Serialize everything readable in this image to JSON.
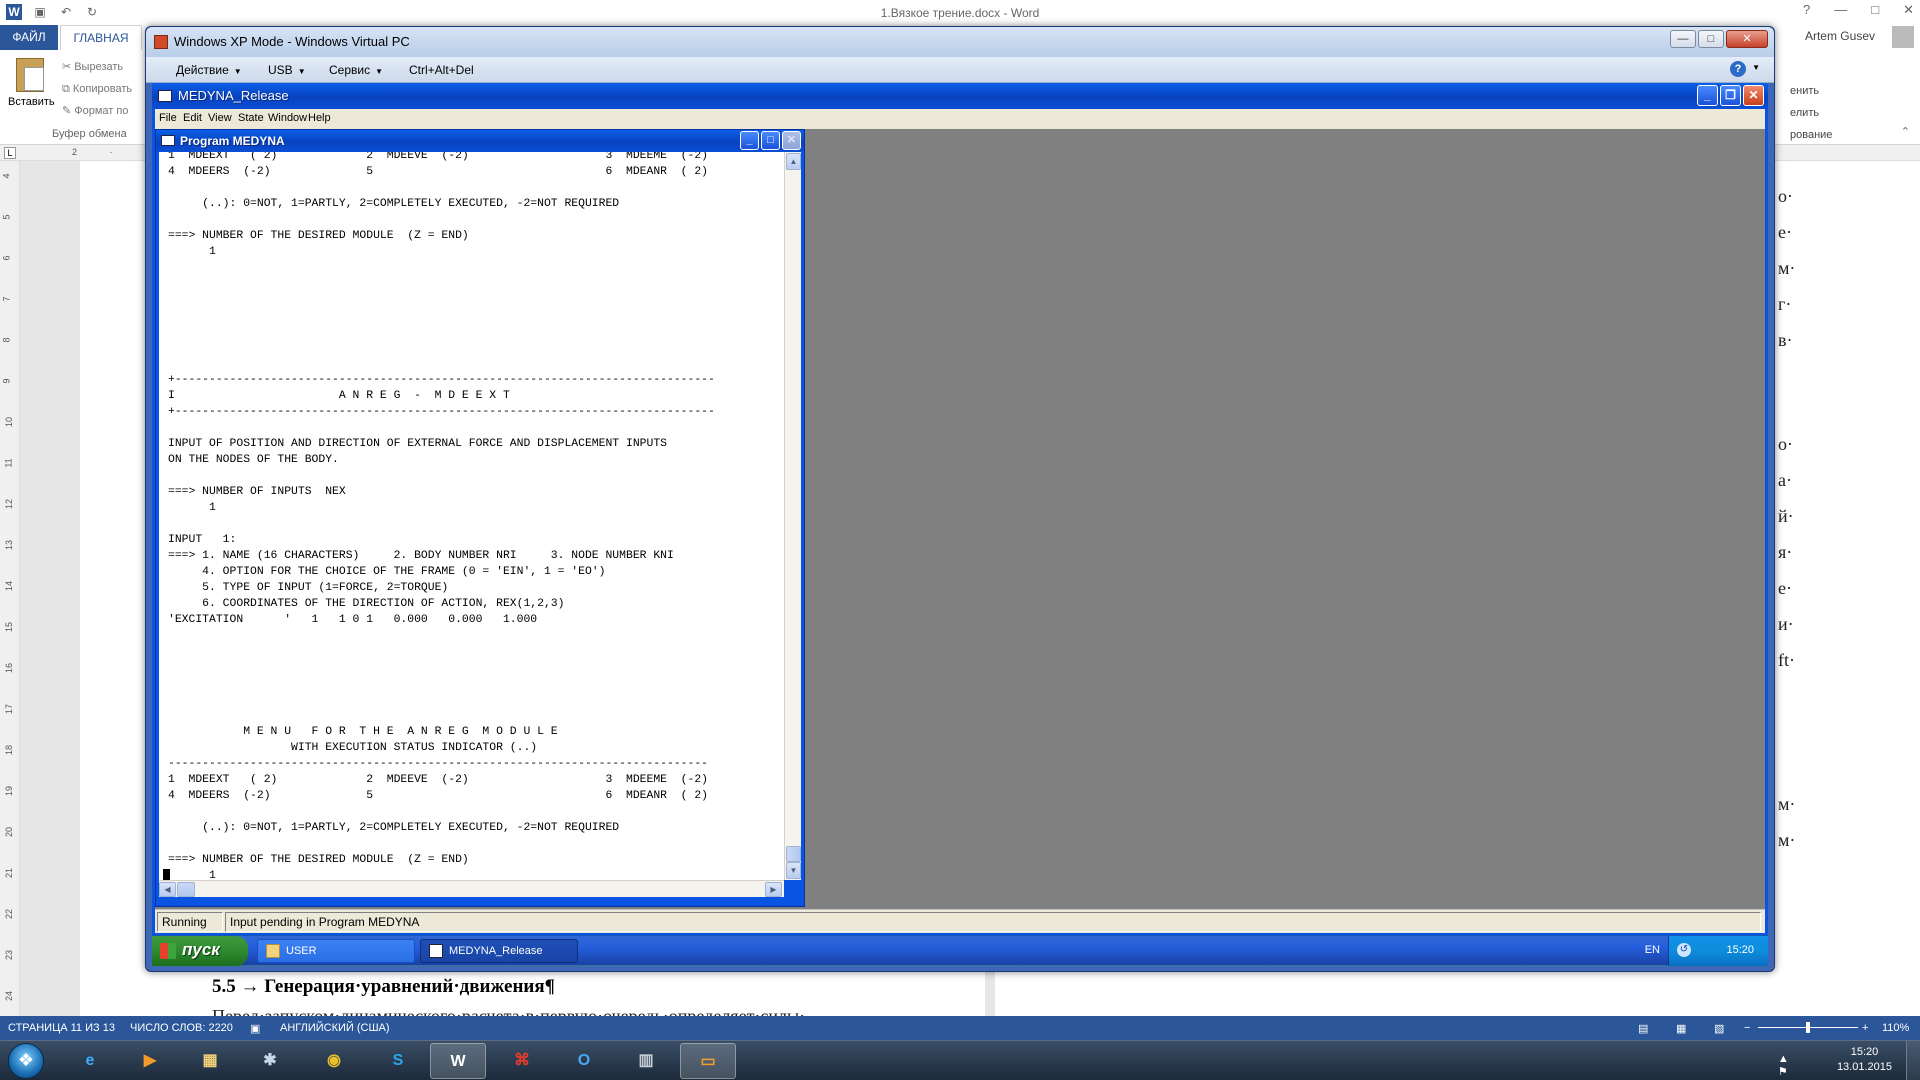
{
  "word": {
    "title": "1.Вязкое трение.docx - Word",
    "file_tab": "ФАЙЛ",
    "home_tab": "ГЛАВНАЯ",
    "user": "Artem Gusev",
    "paste": "Вставить",
    "cut": "Вырезать",
    "copy": "Копировать",
    "format_painter": "Формат по",
    "clipboard_group": "Буфер обмена",
    "right_ribbon": [
      "енить",
      "елить",
      "рование"
    ],
    "ruler_top": "2 · 1 ·",
    "ruler_left": [
      "4",
      "5",
      "6",
      "7",
      "8",
      "9",
      "10",
      "11",
      "12",
      "13",
      "14",
      "15",
      "16",
      "17",
      "18",
      "19",
      "20",
      "21",
      "22",
      "23",
      "24"
    ],
    "doc_heading": "5.5 → Генерация·уравнений·движения¶",
    "doc_para": "Перед·запуском·динамического·расчета·в·первую·очередь·определяет·силы·",
    "edge_text": [
      "о·",
      "е·",
      "м·",
      "г·",
      "в·",
      "о·",
      "а·",
      "й·",
      "я·",
      "е·",
      "и·",
      "ft·",
      "м·",
      "м·"
    ],
    "status": {
      "page": "СТРАНИЦА 11 ИЗ 13",
      "words": "ЧИСЛО СЛОВ: 2220",
      "lang": "АНГЛИЙСКИЙ (США)",
      "zoom": "110%"
    }
  },
  "vpc": {
    "title": "Windows XP Mode - Windows Virtual PC",
    "menu": [
      "Действие",
      "USB",
      "Сервис",
      "Ctrl+Alt+Del"
    ]
  },
  "medyna": {
    "title": "MEDYNA_Release",
    "menu": [
      "File",
      "Edit",
      "View",
      "State",
      "Window",
      "Help"
    ],
    "child_title": "Program MEDYNA",
    "status_state": "Running",
    "status_msg": "Input pending in Program MEDYNA",
    "console_lines": [
      "1  MDEEXT   ( 2)             2  MDEEVE  (-2)                    3  MDEEME  (-2)",
      "4  MDEERS  (-2)              5                                  6  MDEANR  ( 2)",
      "",
      "     (..): 0=NOT, 1=PARTLY, 2=COMPLETELY EXECUTED, -2=NOT REQUIRED",
      "",
      "===> NUMBER OF THE DESIRED MODULE  (Z = END)",
      "      1",
      "",
      "",
      "",
      "",
      "",
      "",
      "",
      "+-------------------------------------------------------------------------------",
      "I                        A N R E G  -  M D E E X T",
      "+-------------------------------------------------------------------------------",
      "",
      "INPUT OF POSITION AND DIRECTION OF EXTERNAL FORCE AND DISPLACEMENT INPUTS",
      "ON THE NODES OF THE BODY.",
      "",
      "===> NUMBER OF INPUTS  NEX",
      "      1",
      "",
      "INPUT   1:",
      "===> 1. NAME (16 CHARACTERS)     2. BODY NUMBER NRI     3. NODE NUMBER KNI",
      "     4. OPTION FOR THE CHOICE OF THE FRAME (0 = 'EIN', 1 = 'EO')",
      "     5. TYPE OF INPUT (1=FORCE, 2=TORQUE)",
      "     6. COORDINATES OF THE DIRECTION OF ACTION, REX(1,2,3)",
      "'EXCITATION      '   1   1 0 1   0.000   0.000   1.000",
      "",
      "",
      "",
      "",
      "",
      "",
      "           M E N U   F O R  T H E  A N R E G  M O D U L E",
      "                  WITH EXECUTION STATUS INDICATOR (..)",
      "-------------------------------------------------------------------------------",
      "1  MDEEXT   ( 2)             2  MDEEVE  (-2)                    3  MDEEME  (-2)",
      "4  MDEERS  (-2)              5                                  6  MDEANR  ( 2)",
      "",
      "     (..): 0=NOT, 1=PARTLY, 2=COMPLETELY EXECUTED, -2=NOT REQUIRED",
      "",
      "===> NUMBER OF THE DESIRED MODULE  (Z = END)",
      "      1"
    ]
  },
  "guest_taskbar": {
    "start": "пуск",
    "tasks": [
      "USER",
      "MEDYNA_Release"
    ],
    "lang": "EN",
    "clock": "15:20"
  },
  "host_taskbar": {
    "time": "15:20",
    "date": "13.01.2015",
    "apps": [
      "ie-icon",
      "media-player-icon",
      "explorer-icon",
      "game-icon",
      "chrome-icon",
      "skype-icon",
      "word-icon",
      "acrobat-icon",
      "outlook-icon",
      "calculator-icon",
      "virtual-pc-icon"
    ]
  },
  "colors": {
    "word_blue": "#2b579a",
    "xp_blue": "#0a54e3",
    "mdi_gray": "#808080"
  }
}
